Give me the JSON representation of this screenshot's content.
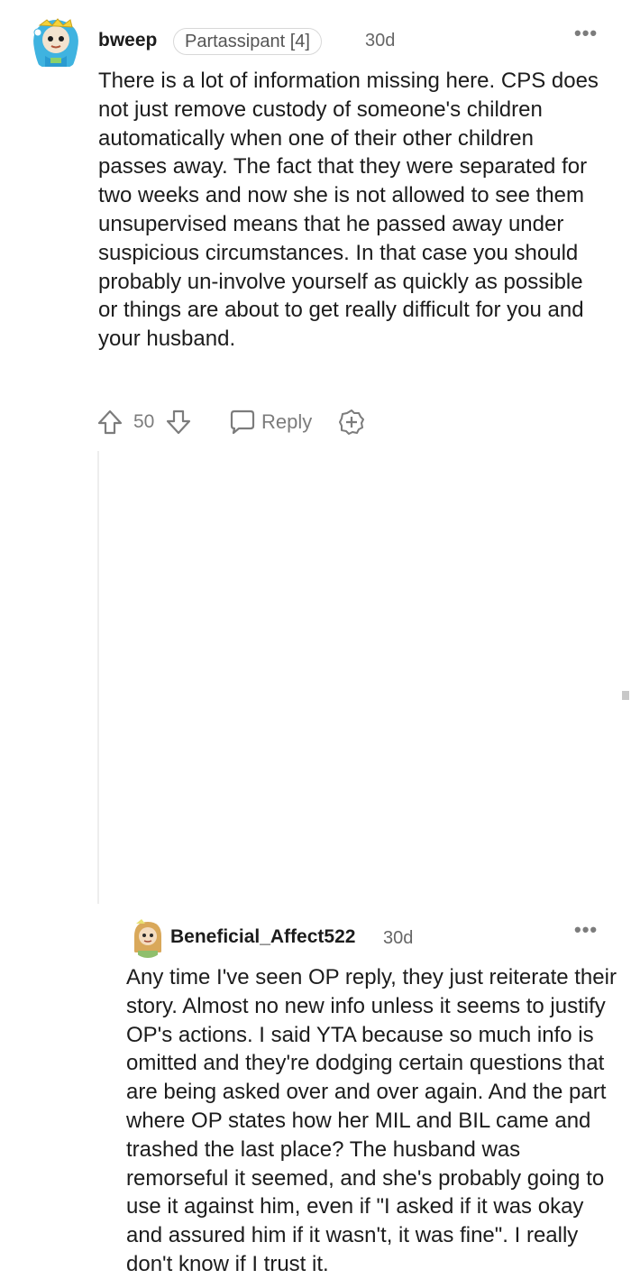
{
  "comments": [
    {
      "username": "bweep",
      "flair": "Partassipant [4]",
      "time": "30d",
      "more": "•••",
      "body": "There is a lot of information missing here. CPS does not just remove custody of someone's children automatically when one of their other children passes away. The fact that they were separated for two weeks and now she is not allowed to see them unsupervised means that he passed away under suspicious circumstances. In that case you should probably un-involve yourself as quickly as possible or things are about to get really difficult for you and your husband.",
      "score": "50",
      "reply_label": "Reply",
      "icons": [
        "upvote-icon",
        "downvote-icon",
        "reply-icon",
        "award-icon"
      ]
    },
    {
      "username": "Beneficial_Affect522",
      "time": "30d",
      "more": "•••",
      "body": "Any time I've seen OP reply, they just reiterate their story. Almost no new info unless it seems to justify OP's actions. I said YTA because so much info is omitted and they're dodging certain questions that are being asked over and over again. And the part where OP states how her MIL and BIL came and trashed the last place? The husband was remorseful it seemed, and she's probably going to use it against him, even if \"I asked if it was okay and assured him if it wasn't, it was fine\". I really don't know if I trust it."
    }
  ],
  "colors": {
    "text": "#1c1c1c",
    "meta": "#7c7c7c",
    "flair_border": "#d8d8d8",
    "thread_line": "#ededed"
  }
}
